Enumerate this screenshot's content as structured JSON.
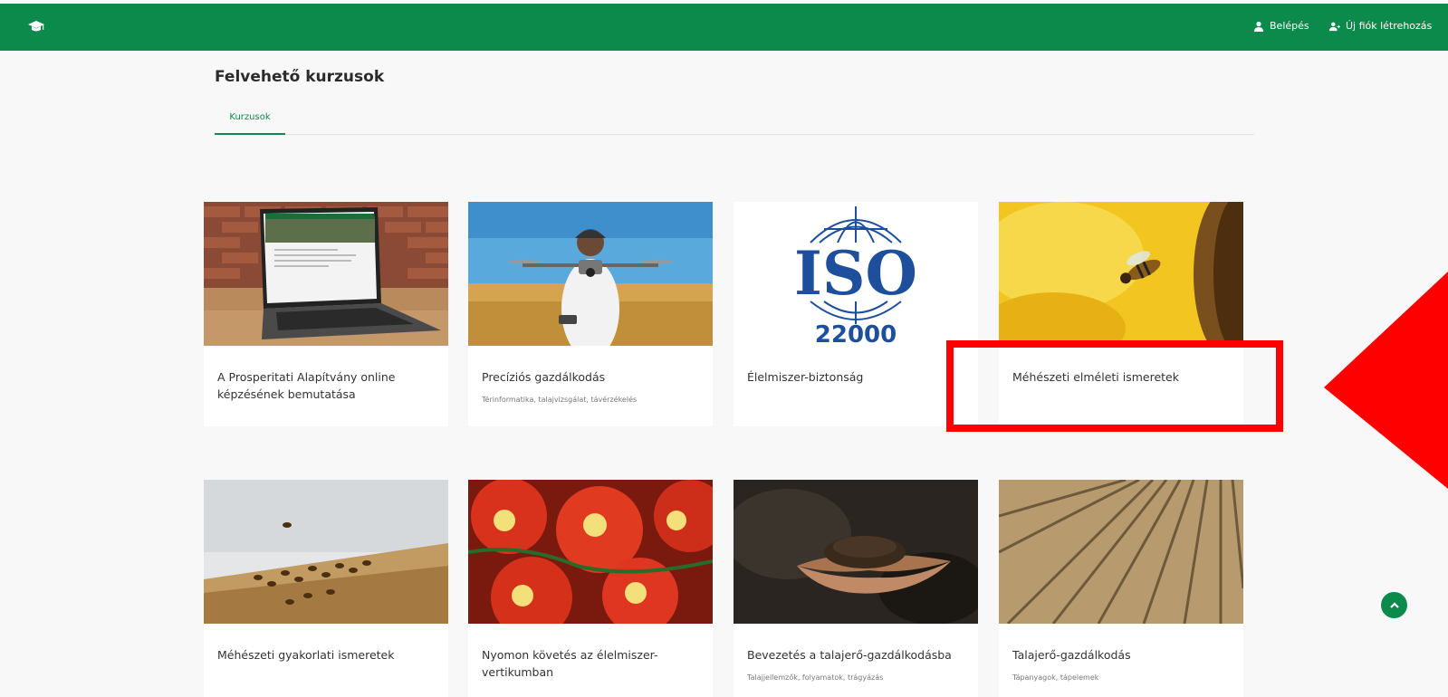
{
  "header": {
    "brand_icon": "graduation-cap-icon",
    "login_label": "Belépés",
    "login_icon": "user-icon",
    "register_label": "Új fiók létrehozás",
    "register_icon": "user-plus-icon",
    "bar_color": "#0b8a4b"
  },
  "main": {
    "title": "Felvehető kurzusok",
    "tabs": [
      {
        "label": "Kurzusok",
        "active": true
      }
    ]
  },
  "courses": [
    {
      "title": "A Prosperitati Alapítvány online képzésének bemutatása",
      "subtitle": "",
      "image": "laptop-image"
    },
    {
      "title": "Precíziós gazdálkodás",
      "subtitle": "Térinformatika, talajvizsgálat, távérzékelés",
      "image": "drone-image"
    },
    {
      "title": "Élelmiszer-biztonság",
      "subtitle": "",
      "image": "iso-22000-logo"
    },
    {
      "title": "Méhészeti elméleti ismeretek",
      "subtitle": "",
      "image": "bee-sunflower-image"
    },
    {
      "title": "Méhészeti gyakorlati ismeretek",
      "subtitle": "",
      "image": "beehive-image"
    },
    {
      "title": "Nyomon követés az élelmiszer-vertikumban",
      "subtitle": "",
      "image": "tomatoes-image"
    },
    {
      "title": "Bevezetés a talajerő-gazdálkodásba",
      "subtitle": "Talajjellemzők, folyamatok, trágyázás",
      "image": "soil-hands-image"
    },
    {
      "title": "Talajerő-gazdálkodás",
      "subtitle": "Tápanyagok, tápelemek",
      "image": "plowed-field-image"
    }
  ],
  "iso_logo": {
    "top_text": "ISO",
    "bottom_text": "22000",
    "color": "#1d4f9c"
  },
  "annotation": {
    "highlight_color": "#ff0000"
  },
  "scroll_top_icon": "chevron-up-icon"
}
